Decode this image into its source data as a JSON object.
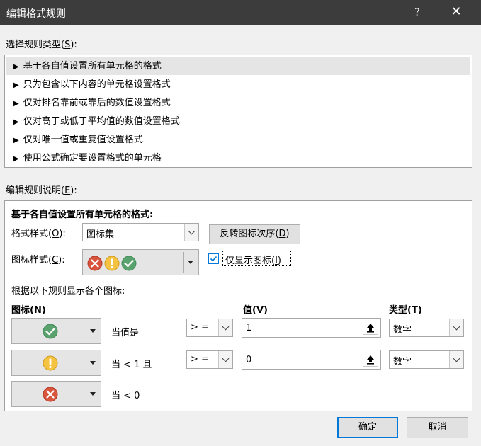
{
  "titlebar": {
    "title": "编辑格式规则",
    "help": "?",
    "close": "✕"
  },
  "rule_type": {
    "label": "选择规则类型(",
    "key": "S",
    "suffix": "):",
    "items": [
      "基于各自值设置所有单元格的格式",
      "只为包含以下内容的单元格设置格式",
      "仅对排名靠前或靠后的数值设置格式",
      "仅对高于或低于平均值的数值设置格式",
      "仅对唯一值或重复值设置格式",
      "使用公式确定要设置格式的单元格"
    ],
    "arrow": "▶"
  },
  "description": {
    "label": "编辑规则说明(",
    "key": "E",
    "suffix": "):",
    "heading": "基于各自值设置所有单元格的格式:",
    "format_style_label": "格式样式(",
    "format_style_key": "O",
    "format_style_suffix": "):",
    "format_style_value": "图标集",
    "reverse_btn": "反转图标次序(",
    "reverse_key": "D",
    "reverse_suffix": ")",
    "icon_style_label": "图标样式(",
    "icon_style_key": "C",
    "icon_style_suffix": "):",
    "show_icon_only": "仅显示图标(",
    "show_icon_key": "I",
    "show_icon_suffix": ")",
    "show_icon_checked": true,
    "rules_heading": "根据以下规则显示各个图标:",
    "col_icon": "图标(",
    "col_icon_key": "N",
    "col_value": "值(",
    "col_value_key": "V",
    "col_type": "类型(",
    "col_type_key": "T",
    "col_close": ")",
    "rows": [
      {
        "icon": "check-icon",
        "condition": "当值是",
        "op": "> =",
        "value": "1",
        "type": "数字"
      },
      {
        "icon": "exclamation-icon",
        "condition": "当 < 1 且",
        "op": "> =",
        "value": "0",
        "type": "数字"
      },
      {
        "icon": "cross-icon",
        "condition": "当 < 0"
      }
    ]
  },
  "buttons": {
    "ok": "确定",
    "cancel": "取消"
  },
  "colors": {
    "green": "#5aa36f",
    "yellow": "#f5c342",
    "red": "#d9533d",
    "accent": "#0078d7"
  }
}
